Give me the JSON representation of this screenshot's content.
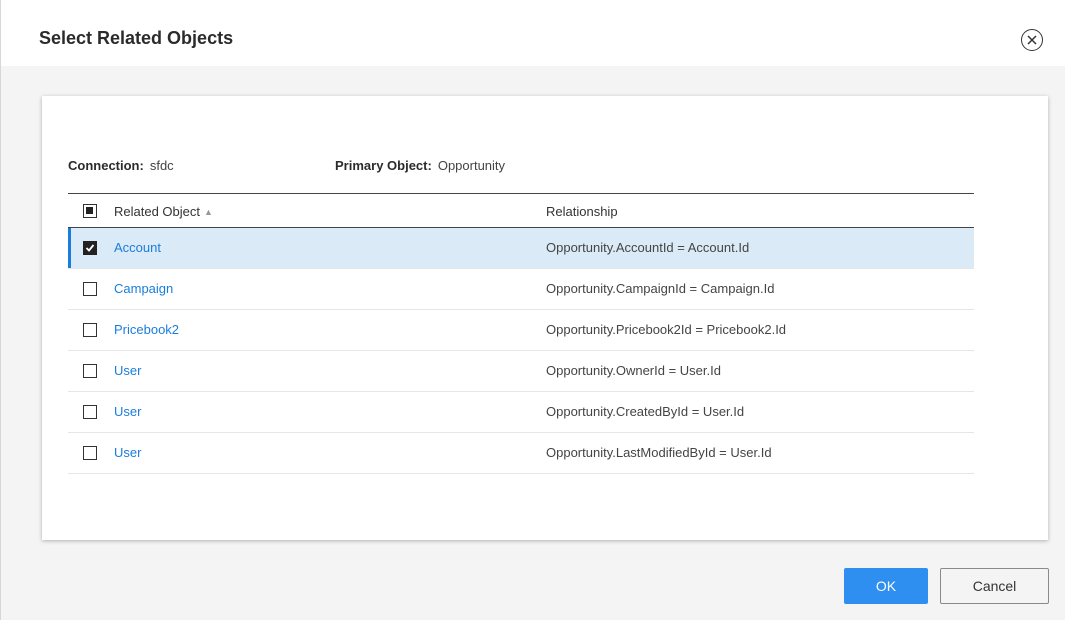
{
  "dialog": {
    "title": "Select Related Objects",
    "close_icon": "circle-x-icon"
  },
  "meta": {
    "connection_label": "Connection:",
    "connection_value": "sfdc",
    "primary_label": "Primary Object:",
    "primary_value": "Opportunity"
  },
  "table": {
    "header": {
      "select_all_state": "indeterminate",
      "name_label": "Related Object",
      "sort_icon": "sort-ascending-icon",
      "relationship_label": "Relationship"
    },
    "rows": [
      {
        "name": "Account",
        "relationship": "Opportunity.AccountId = Account.Id",
        "checked": true,
        "selected": true
      },
      {
        "name": "Campaign",
        "relationship": "Opportunity.CampaignId = Campaign.Id",
        "checked": false,
        "selected": false
      },
      {
        "name": "Pricebook2",
        "relationship": "Opportunity.Pricebook2Id = Pricebook2.Id",
        "checked": false,
        "selected": false
      },
      {
        "name": "User",
        "relationship": "Opportunity.OwnerId = User.Id",
        "checked": false,
        "selected": false
      },
      {
        "name": "User",
        "relationship": "Opportunity.CreatedById = User.Id",
        "checked": false,
        "selected": false
      },
      {
        "name": "User",
        "relationship": "Opportunity.LastModifiedById = User.Id",
        "checked": false,
        "selected": false
      }
    ]
  },
  "footer": {
    "ok_label": "OK",
    "cancel_label": "Cancel"
  },
  "colors": {
    "accent": "#2f8ff0",
    "link": "#1a7ddc",
    "selected_row": "#dbeaf7"
  }
}
